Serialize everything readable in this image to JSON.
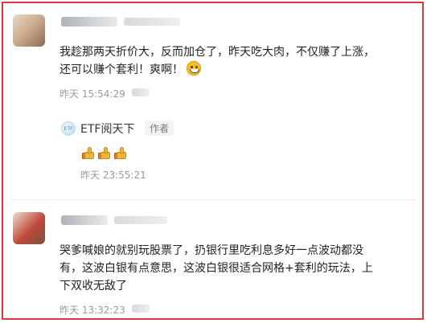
{
  "comments": [
    {
      "text_line1": "我趁那两天折价大，反而加仓了，昨天吃大肉，不仅赚了上涨，",
      "text_line2": "还可以赚个套利！爽啊！",
      "time": "昨天 15:54:29",
      "reply": {
        "author": "ETF阅天下",
        "author_tag": "作者",
        "logo_text": "ETF",
        "time": "昨天 23:55:21"
      }
    },
    {
      "text_line1": "哭爹喊娘的就别玩股票了，扔银行里吃利息多好一点波动都没",
      "text_line2": "有，这波白银有点意思，这波白银很适合网格+套利的玩法，上",
      "text_line3": "下双收无敌了",
      "time": "昨天 13:32:23"
    }
  ]
}
